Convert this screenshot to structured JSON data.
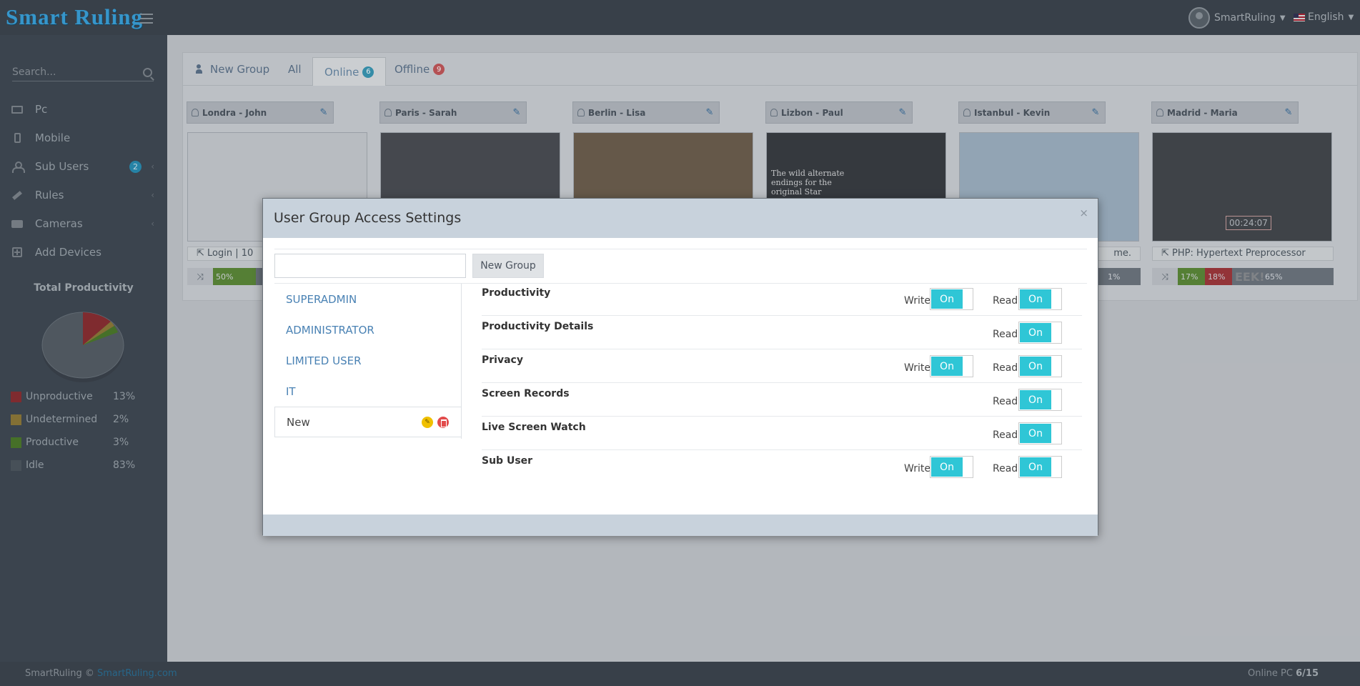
{
  "app": {
    "logo": "Smart Ruling"
  },
  "topbar": {
    "user": "SmartRuling",
    "language": "English"
  },
  "sidebar": {
    "search_placeholder": "Search...",
    "items": [
      {
        "label": "Pc",
        "icon": "monitor-icon"
      },
      {
        "label": "Mobile",
        "icon": "mobile-icon"
      },
      {
        "label": "Sub Users",
        "icon": "user-icon",
        "badge": "2"
      },
      {
        "label": "Rules",
        "icon": "gavel-icon"
      },
      {
        "label": "Cameras",
        "icon": "camera-icon"
      },
      {
        "label": "Add Devices",
        "icon": "plus-square-icon"
      }
    ],
    "productivity": {
      "title": "Total Productivity",
      "legend": [
        {
          "label": "Unproductive",
          "value": "13%",
          "color": "#8a2f33"
        },
        {
          "label": "Undetermined",
          "value": "2%",
          "color": "#8f7a3a"
        },
        {
          "label": "Productive",
          "value": "3%",
          "color": "#4d7a2c"
        },
        {
          "label": "Idle",
          "value": "83%",
          "color": "#4e5760"
        }
      ]
    }
  },
  "tabs": {
    "new_group": "New Group",
    "all": "All",
    "online": "Online",
    "online_count": "6",
    "offline": "Offline",
    "offline_count": "9"
  },
  "cards": [
    {
      "name": "Londra - John",
      "title": "Login | 10",
      "bar": [
        "50%"
      ]
    },
    {
      "name": "Paris - Sarah"
    },
    {
      "name": "Berlin - Lisa"
    },
    {
      "name": "Lizbon - Paul",
      "shot_text": "The wild alternate endings for the original Star"
    },
    {
      "name": "Istanbul - Kevin",
      "title": "me.",
      "bar": [
        "1%"
      ]
    },
    {
      "name": "Madrid - Maria",
      "title": "PHP: Hypertext Preprocessor",
      "timer": "00:24:07",
      "bar": [
        "17%",
        "18%",
        "EEK!",
        "65%"
      ]
    }
  ],
  "modal": {
    "title": "User Group Access Settings",
    "close": "×",
    "input_placeholder": "",
    "new_group_button": "New Group",
    "groups": [
      "SUPERADMIN",
      "ADMINISTRATOR",
      "LIMITED USER",
      "IT",
      "New"
    ],
    "permissions": [
      {
        "name": "Productivity",
        "write": "Write",
        "write_state": "On",
        "read": "Read",
        "read_state": "On"
      },
      {
        "name": "Productivity Details",
        "read": "Read",
        "read_state": "On"
      },
      {
        "name": "Privacy",
        "write": "Write",
        "write_state": "On",
        "read": "Read",
        "read_state": "On"
      },
      {
        "name": "Screen Records",
        "read": "Read",
        "read_state": "On"
      },
      {
        "name": "Live Screen Watch",
        "read": "Read",
        "read_state": "On"
      },
      {
        "name": "Sub User",
        "write": "Write",
        "write_state": "On",
        "read": "Read",
        "read_state": "On"
      }
    ]
  },
  "footer": {
    "brand": "SmartRuling ©",
    "link": "SmartRuling.com",
    "online_label": "Online PC",
    "online_value": "6/15"
  },
  "colors": {
    "accent": "#2fc6d6",
    "topbar": "#3d4650",
    "sidebar": "#404a55"
  }
}
